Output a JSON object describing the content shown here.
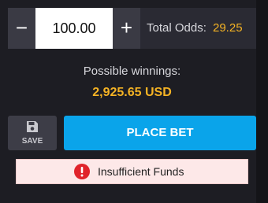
{
  "stake": {
    "decrement_label": "−",
    "increment_label": "+",
    "value": "100.00"
  },
  "odds": {
    "label": "Total Odds:",
    "value": "29.25"
  },
  "winnings": {
    "label": "Possible winnings:",
    "value": "2,925.65 USD"
  },
  "actions": {
    "save_label": "SAVE",
    "place_bet_label": "PLACE BET"
  },
  "alert": {
    "message": "Insufficient Funds"
  },
  "colors": {
    "accent": "#0aa4ea",
    "highlight": "#f5b324",
    "error": "#e0242b"
  },
  "icons": {
    "save": "save-disk-icon",
    "alert": "exclamation-circle-icon"
  }
}
